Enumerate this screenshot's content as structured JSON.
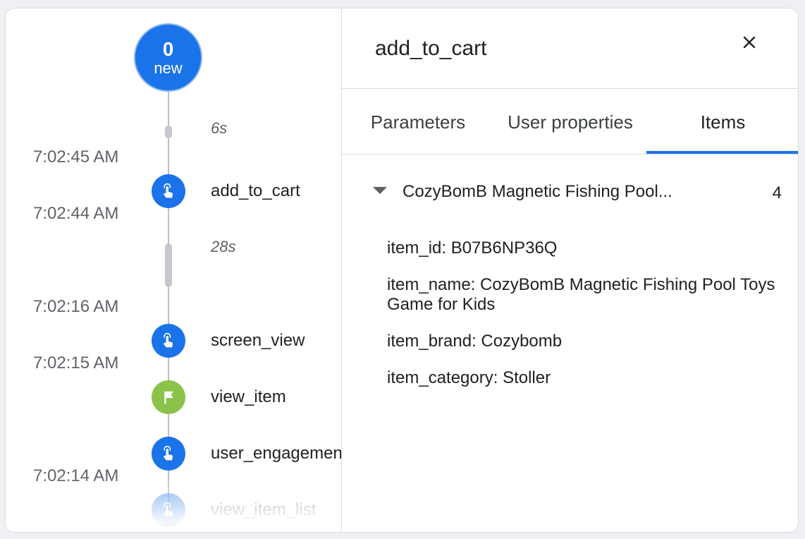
{
  "timeline": {
    "new_badge": {
      "count": "0",
      "label": "new"
    },
    "durations": [
      "6s",
      "28s"
    ],
    "timestamps": [
      "7:02:45 AM",
      "7:02:44 AM",
      "7:02:16 AM",
      "7:02:15 AM",
      "7:02:14 AM"
    ],
    "events": [
      {
        "name": "add_to_cart",
        "icon": "touch-icon",
        "color": "#1a73e8"
      },
      {
        "name": "screen_view",
        "icon": "touch-icon",
        "color": "#1a73e8"
      },
      {
        "name": "view_item",
        "icon": "flag-icon",
        "color": "#8bc34a"
      },
      {
        "name": "user_engagement",
        "icon": "touch-icon",
        "color": "#1a73e8"
      },
      {
        "name": "view_item_list",
        "icon": "touch-icon",
        "color": "#1a73e8"
      }
    ]
  },
  "detail": {
    "title": "add_to_cart",
    "close_icon": "close-icon",
    "tabs": [
      {
        "label": "Parameters",
        "active": false
      },
      {
        "label": "User properties",
        "active": false
      },
      {
        "label": "Items",
        "active": true
      }
    ],
    "item": {
      "title": "CozyBomB Magnetic Fishing Pool...",
      "count": "4",
      "expanded": true,
      "params": [
        "item_id: B07B6NP36Q",
        "item_name: CozyBomB Magnetic Fishing Pool Toys Game for Kids",
        "item_brand: Cozybomb",
        "item_category: Stoller"
      ]
    }
  },
  "colors": {
    "accent": "#1a73e8",
    "green": "#8bc34a",
    "divider": "#dadce0"
  }
}
